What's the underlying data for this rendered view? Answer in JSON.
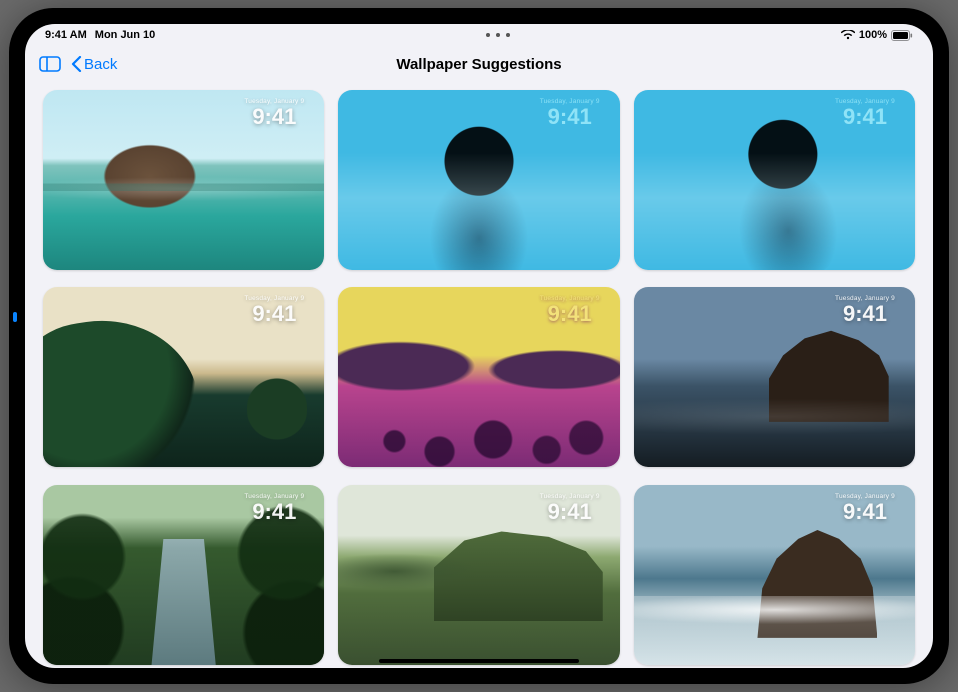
{
  "status": {
    "time": "9:41 AM",
    "date": "Mon Jun 10",
    "battery_pct": "100%"
  },
  "nav": {
    "back_label": "Back",
    "title": "Wallpaper Suggestions"
  },
  "tile_overlay": {
    "date": "Tuesday, January 9",
    "time": "9:41"
  },
  "tiles": [
    {
      "id": "mountain-lagoon",
      "style": "sc1",
      "variant": "light-text"
    },
    {
      "id": "portrait-cyan-1",
      "style": "sc2",
      "variant": "cyan"
    },
    {
      "id": "portrait-cyan-2",
      "style": "sc3",
      "variant": "cyan"
    },
    {
      "id": "cliff-greenery",
      "style": "sc4",
      "variant": "light-text"
    },
    {
      "id": "beach-duotone",
      "style": "sc5",
      "variant": "duotone"
    },
    {
      "id": "sea-stack-dark",
      "style": "sc6",
      "variant": "light-text"
    },
    {
      "id": "jungle-stream",
      "style": "sc7",
      "variant": "light-text"
    },
    {
      "id": "highlands-cliff",
      "style": "sc8",
      "variant": "light-text"
    },
    {
      "id": "sea-rock-surf",
      "style": "sc9",
      "variant": "light-text"
    }
  ]
}
